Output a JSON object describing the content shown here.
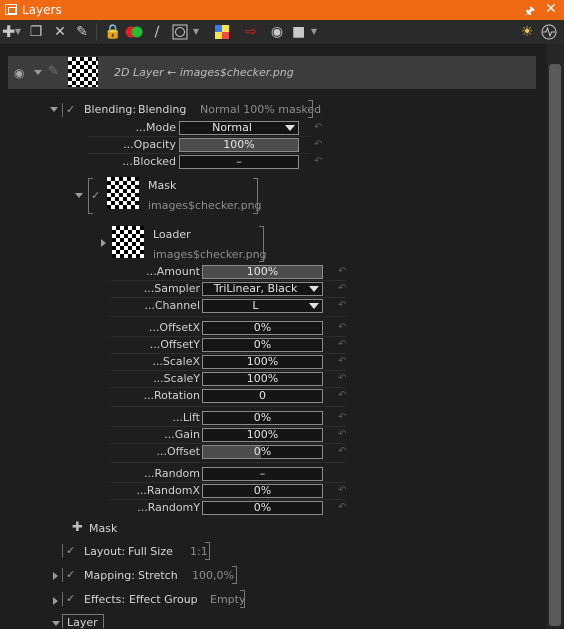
{
  "window": {
    "title": "Layers",
    "pin_icon": "pin-icon",
    "close_icon": "close-icon"
  },
  "layer": {
    "name": "2D Layer ← images$checker.png"
  },
  "blending": {
    "label": "Blending:",
    "value": "Blending",
    "summary": "Normal 100% masked",
    "mode_label": "...Mode",
    "mode_value": "Normal",
    "opacity_label": "...Opacity",
    "opacity_value": "100%",
    "blocked_label": "...Blocked",
    "blocked_value": "–"
  },
  "mask": {
    "title": "Mask",
    "source": "images$checker.png"
  },
  "loader": {
    "title": "Loader",
    "source": "images$checker.png",
    "amount_label": "...Amount",
    "amount_value": "100%",
    "sampler_label": "...Sampler",
    "sampler_value": "TriLinear, Black",
    "channel_label": "...Channel",
    "channel_value": "L",
    "offsetx_label": "...OffsetX",
    "offsetx_value": "0%",
    "offsety_label": "...OffsetY",
    "offsety_value": "0%",
    "scalex_label": "...ScaleX",
    "scalex_value": "100%",
    "scaley_label": "...ScaleY",
    "scaley_value": "100%",
    "rotation_label": "...Rotation",
    "rotation_value": "0",
    "lift_label": "...Lift",
    "lift_value": "0%",
    "gain_label": "...Gain",
    "gain_value": "100%",
    "offset_label": "...Offset",
    "offset_value": "0%",
    "random_label": "...Random",
    "random_value": "–",
    "randomx_label": "...RandomX",
    "randomx_value": "0%",
    "randomy_label": "...RandomY",
    "randomy_value": "0%"
  },
  "add_mask": {
    "label": "Mask"
  },
  "layout": {
    "label": "Layout:",
    "value": "Full Size",
    "summary": "1:1"
  },
  "mapping": {
    "label": "Mapping:",
    "value": "Stretch",
    "summary": "100,0%"
  },
  "effects": {
    "label": "Effects:",
    "value": "Effect Group",
    "summary": "Empty"
  },
  "layer_section": {
    "label": "Layer"
  },
  "colors": {
    "titlebar": "#f06a14",
    "background": "#1e1e1e",
    "selected_row": "#3c3c3c"
  }
}
